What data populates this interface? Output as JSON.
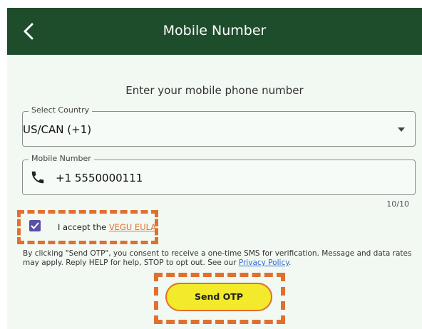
{
  "header": {
    "title": "Mobile Number",
    "back_icon": "chevron-left-icon"
  },
  "main": {
    "prompt": "Enter your mobile phone number",
    "country": {
      "label": "Select Country",
      "value": "US/CAN (+1)",
      "caret_icon": "caret-down-icon"
    },
    "mobile": {
      "label": "Mobile Number",
      "value": "+1 5550000111",
      "icon": "phone-icon",
      "counter": "10/10"
    },
    "eula": {
      "checked": true,
      "text": "I accept the ",
      "link": "VEGU EULA"
    },
    "consent": {
      "text": "By clicking \"Send OTP\", you consent to receive a one-time SMS for verification. Message and data rates may apply. Reply HELP for help, STOP to opt out. See our ",
      "link": "Privacy Policy",
      "suffix": "."
    },
    "send_otp_label": "Send OTP"
  },
  "colors": {
    "header_bg": "#1e4d2b",
    "page_bg": "#f2f8f2",
    "accent_orange": "#e0702e",
    "button_yellow": "#f2ea2a",
    "checkbox_purple": "#5a4ea8",
    "link_blue": "#2f6bd6"
  }
}
